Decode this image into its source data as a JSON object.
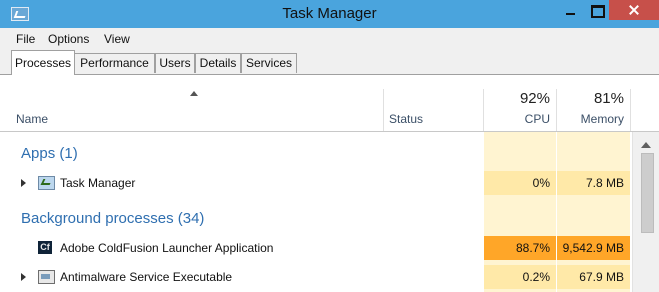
{
  "window": {
    "title": "Task Manager"
  },
  "menu": [
    "File",
    "Options",
    "View"
  ],
  "tabs": [
    "Processes",
    "Performance",
    "Users",
    "Details",
    "Services"
  ],
  "columns": {
    "name": "Name",
    "status": "Status",
    "cpu_pct": "92%",
    "cpu_label": "CPU",
    "mem_pct": "81%",
    "mem_label": "Memory"
  },
  "groups": [
    {
      "title": "Apps (1)",
      "rows": [
        {
          "name": "Task Manager",
          "icon": "task-manager-icon",
          "cpu": "0%",
          "memory": "7.8 MB"
        }
      ]
    },
    {
      "title": "Background processes (34)",
      "rows": [
        {
          "name": "Adobe ColdFusion Launcher Application",
          "icon": "coldfusion-icon",
          "icon_text": "Cf",
          "cpu": "88.7%",
          "memory": "9,542.9 MB"
        },
        {
          "name": "Antimalware Service Executable",
          "icon": "service-icon",
          "cpu": "0.2%",
          "memory": "67.9 MB"
        }
      ]
    }
  ],
  "colors": {
    "titlebar": "#4aa4dd",
    "heat_low": "#fff4d1",
    "heat_mid": "#ffe9a8",
    "heat_high": "#ffa628",
    "group_title": "#2f6fb0"
  }
}
